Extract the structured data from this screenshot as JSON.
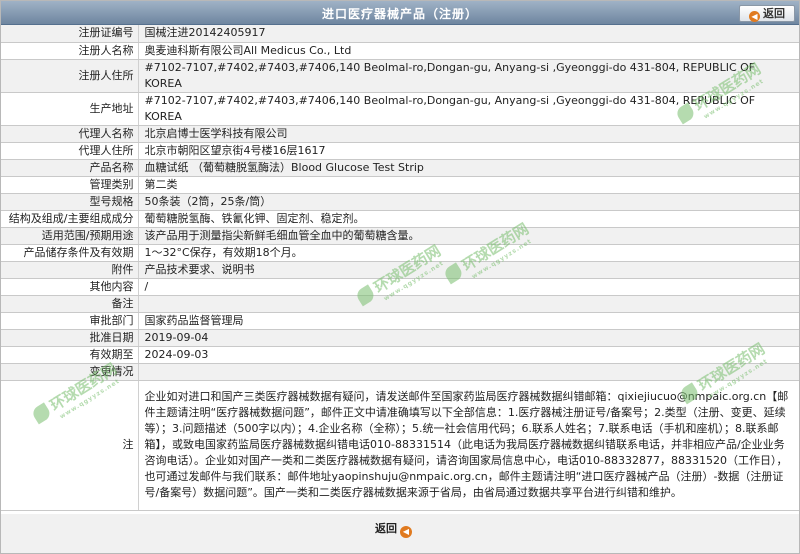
{
  "header": {
    "title": "进口医疗器械产品（注册）",
    "back_label": "返回"
  },
  "rows": [
    {
      "label": "注册证编号",
      "value": "国械注进20142405917"
    },
    {
      "label": "注册人名称",
      "value": "奥麦迪科斯有限公司All Medicus Co., Ltd"
    },
    {
      "label": "注册人住所",
      "value": "#7102-7107,#7402,#7403,#7406,140 Beolmal-ro,Dongan-gu, Anyang-si ,Gyeonggi-do 431-804, REPUBLIC OF KOREA"
    },
    {
      "label": "生产地址",
      "value": "#7102-7107,#7402,#7403,#7406,140 Beolmal-ro,Dongan-gu, Anyang-si ,Gyeonggi-do 431-804, REPUBLIC OF KOREA"
    },
    {
      "label": "代理人名称",
      "value": "北京启博士医学科技有限公司"
    },
    {
      "label": "代理人住所",
      "value": "北京市朝阳区望京街4号楼16层1617"
    },
    {
      "label": "产品名称",
      "value": "血糖试纸 （葡萄糖脱氢酶法）Blood Glucose Test Strip"
    },
    {
      "label": "管理类别",
      "value": "第二类"
    },
    {
      "label": "型号规格",
      "value": "50条装（2筒，25条/筒）"
    },
    {
      "label": "结构及组成/主要组成成分",
      "value": "葡萄糖脱氢酶、铁氰化钾、固定剂、稳定剂。"
    },
    {
      "label": "适用范围/预期用途",
      "value": "该产品用于测量指尖新鲜毛细血管全血中的葡萄糖含量。"
    },
    {
      "label": "产品储存条件及有效期",
      "value": "1～32°C保存，有效期18个月。"
    },
    {
      "label": "附件",
      "value": "产品技术要求、说明书"
    },
    {
      "label": "其他内容",
      "value": "/"
    },
    {
      "label": "备注",
      "value": ""
    },
    {
      "label": "审批部门",
      "value": "国家药品监督管理局"
    },
    {
      "label": "批准日期",
      "value": "2019-09-04"
    },
    {
      "label": "有效期至",
      "value": "2024-09-03"
    },
    {
      "label": "变更情况",
      "value": ""
    },
    {
      "label": "注",
      "value": "企业如对进口和国产三类医疗器械数据有疑问，请发送邮件至国家药监局医疗器械数据纠错邮箱：qixiejiucuo@nmpaic.org.cn【邮件主题请注明“医疗器械数据问题”，邮件正文中请准确填写以下全部信息：1.医疗器械注册证号/备案号；2.类型（注册、变更、延续等）；3.问题描述（500字以内）；4.企业名称（全称）；5.统一社会信用代码；6.联系人姓名；7.联系电话（手机和座机）；8.联系邮箱】，或致电国家药监局医疗器械数据纠错电话010-88331514（此电话为我局医疗器械数据纠错联系电话，并非相应产品/企业业务咨询电话）。企业如对国产一类和二类医疗器械数据有疑问，请咨询国家局信息中心，电话010-88332877，88331520（工作日），也可通过发邮件与我们联系：邮件地址yaopinshuju@nmpaic.org.cn，邮件主题请注明“进口医疗器械产品（注册）-数据（注册证号/备案号）数据问题”。国产一类和二类医疗器械数据来源于省局，由省局通过数据共享平台进行纠错和维护。"
    }
  ],
  "watermark": {
    "brand": "环球医药网",
    "sub": "www.qgyyzs.net"
  }
}
